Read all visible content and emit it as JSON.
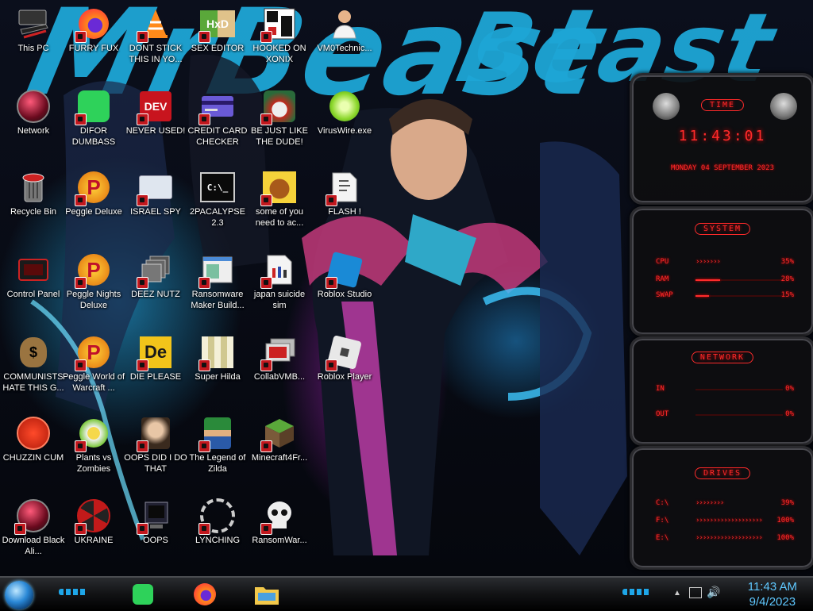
{
  "wallpaper": {
    "brand_left": "MrBeast",
    "brand_right": "Beast"
  },
  "icons": [
    {
      "label": "This PC"
    },
    {
      "label": "Network"
    },
    {
      "label": "Recycle Bin"
    },
    {
      "label": "Control Panel"
    },
    {
      "label": "COMMUNISTS HATE THIS G..."
    },
    {
      "label": "CHUZZIN CUM"
    },
    {
      "label": "Download Black Ali..."
    },
    {
      "label": "FURRY FUX"
    },
    {
      "label": "DIFOR DUMBASS"
    },
    {
      "label": "Peggle Deluxe"
    },
    {
      "label": "Peggle Nights Deluxe"
    },
    {
      "label": "Peggle World of Warcraft ..."
    },
    {
      "label": "Plants vs Zombies"
    },
    {
      "label": "UKRAINE"
    },
    {
      "label": "DONT STICK THIS IN YO..."
    },
    {
      "label": "NEVER USED!"
    },
    {
      "label": "ISRAEL SPY"
    },
    {
      "label": "DEEZ NUTZ"
    },
    {
      "label": "DIE PLEASE"
    },
    {
      "label": "OOPS DID I DO THAT"
    },
    {
      "label": "OOPS"
    },
    {
      "label": "SEX EDITOR"
    },
    {
      "label": "CREDIT CARD CHECKER"
    },
    {
      "label": "2PACALYPSE 2.3"
    },
    {
      "label": "Ransomware Maker Build..."
    },
    {
      "label": "Super Hilda"
    },
    {
      "label": "The Legend of Zilda"
    },
    {
      "label": "LYNCHING"
    },
    {
      "label": "HOOKED ON XONIX"
    },
    {
      "label": "BE JUST LIKE THE DUDE!"
    },
    {
      "label": "some of you need to ac..."
    },
    {
      "label": "japan suicide sim"
    },
    {
      "label": "CollabVMB..."
    },
    {
      "label": "Minecraft4Fr..."
    },
    {
      "label": "RansomWar..."
    },
    {
      "label": "VM0Technic..."
    },
    {
      "label": "VirusWire.exe"
    },
    {
      "label": "FLASH !"
    },
    {
      "label": "Roblox Studio"
    },
    {
      "label": "Roblox Player"
    }
  ],
  "icon_glyphs": {
    "dev_text": "DEV",
    "p_letter": "P",
    "de_text": "De",
    "cmd_text": "C:\\_"
  },
  "gadgets": {
    "time": {
      "title": "TIME",
      "clock": "11:43:01",
      "date": "MONDAY 04 SEPTEMBER 2023"
    },
    "system": {
      "title": "SYSTEM",
      "rows": [
        {
          "key": "CPU",
          "value": "35%",
          "pct": 0.35
        },
        {
          "key": "RAM",
          "value": "28%",
          "pct": 0.28
        },
        {
          "key": "SWAP",
          "value": "15%",
          "pct": 0.15
        }
      ]
    },
    "network": {
      "title": "NETWORK",
      "rows": [
        {
          "key": "IN",
          "value": "0%",
          "pct": 0.0
        },
        {
          "key": "OUT",
          "value": "0%",
          "pct": 0.0
        }
      ]
    },
    "drives": {
      "title": "DRIVES",
      "rows": [
        {
          "key": "C:\\",
          "value": "39%",
          "pct": 0.39
        },
        {
          "key": "F:\\",
          "value": "100%",
          "pct": 1.0
        },
        {
          "key": "E:\\",
          "value": "100%",
          "pct": 1.0
        }
      ]
    }
  },
  "taskbar": {
    "pinned": [
      "Spotify",
      "Firefox",
      "File Explorer"
    ],
    "clock_time": "11:43 AM",
    "clock_date": "9/4/2023"
  },
  "colors": {
    "accent": "#1fb6ff",
    "gadget_red": "#ff2b2b",
    "clock": "#5fc8ff"
  }
}
